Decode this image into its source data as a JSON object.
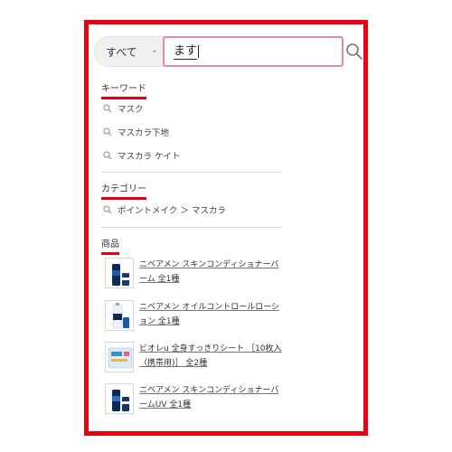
{
  "search": {
    "category": "すべて",
    "query": "ます"
  },
  "keywords": {
    "title": "キーワード",
    "items": [
      "マスク",
      "マスカラ下地",
      "マスカラ ケイト"
    ]
  },
  "categories": {
    "title": "カテゴリー",
    "items": [
      "ポイントメイク ＞ マスカラ"
    ]
  },
  "products": {
    "title": "商品",
    "items": [
      {
        "name": "ニベアメン スキンコンディショナーバーム 全1種"
      },
      {
        "name": "ニベアメン オイルコントロールローション 全1種"
      },
      {
        "name": "ビオレu 全身すっきりシート ［10枚入（携帯用)］ 全2種"
      },
      {
        "name": "ニベアメン スキンコンディショナーバームUV 全1種"
      }
    ]
  },
  "colors": {
    "frame": "#e60012",
    "input_border": "#e58aa6"
  },
  "icons": [
    "chevron-down-icon",
    "search-icon"
  ]
}
